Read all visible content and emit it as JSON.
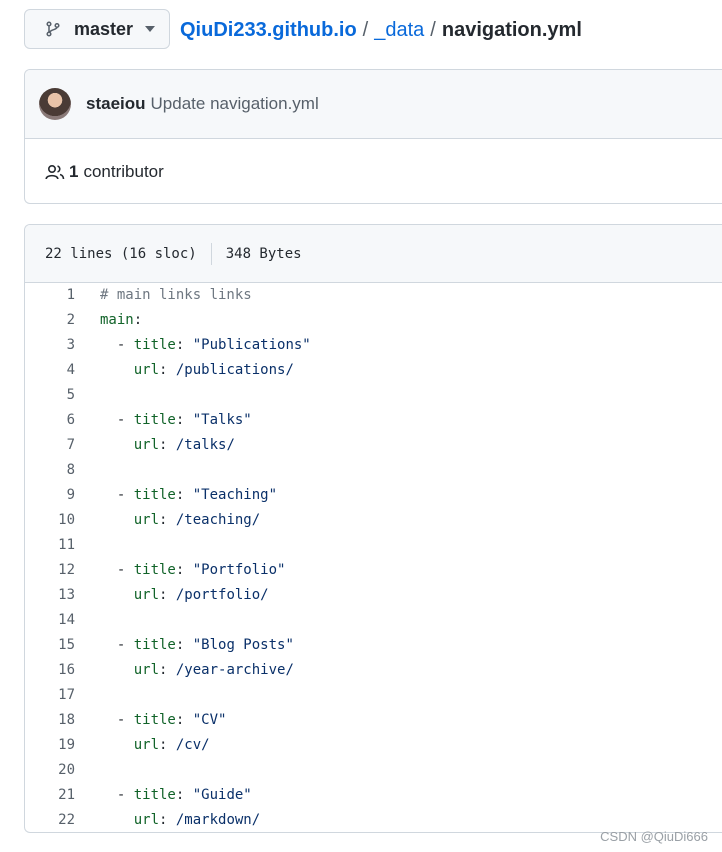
{
  "branch": {
    "name": "master",
    "icon": "git-branch-icon"
  },
  "breadcrumb": {
    "repo": "QiuDi233.github.io",
    "separator": "/",
    "folder": "_data",
    "file": "navigation.yml"
  },
  "commit": {
    "author": "staeiou",
    "message": "Update navigation.yml"
  },
  "contributors": {
    "count": "1",
    "label": "contributor"
  },
  "file_info": {
    "lines": "22 lines (16 sloc)",
    "size": "348 Bytes"
  },
  "code_lines": [
    {
      "n": "1",
      "tokens": [
        {
          "t": "comment",
          "v": "# main links links"
        }
      ]
    },
    {
      "n": "2",
      "tokens": [
        {
          "t": "key",
          "v": "main"
        },
        {
          "t": "plain",
          "v": ":"
        }
      ]
    },
    {
      "n": "3",
      "tokens": [
        {
          "t": "plain",
          "v": "  - "
        },
        {
          "t": "key",
          "v": "title"
        },
        {
          "t": "plain",
          "v": ": "
        },
        {
          "t": "str",
          "v": "\"Publications\""
        }
      ]
    },
    {
      "n": "4",
      "tokens": [
        {
          "t": "plain",
          "v": "    "
        },
        {
          "t": "key",
          "v": "url"
        },
        {
          "t": "plain",
          "v": ": "
        },
        {
          "t": "str",
          "v": "/publications/"
        }
      ]
    },
    {
      "n": "5",
      "tokens": []
    },
    {
      "n": "6",
      "tokens": [
        {
          "t": "plain",
          "v": "  - "
        },
        {
          "t": "key",
          "v": "title"
        },
        {
          "t": "plain",
          "v": ": "
        },
        {
          "t": "str",
          "v": "\"Talks\""
        }
      ]
    },
    {
      "n": "7",
      "tokens": [
        {
          "t": "plain",
          "v": "    "
        },
        {
          "t": "key",
          "v": "url"
        },
        {
          "t": "plain",
          "v": ": "
        },
        {
          "t": "str",
          "v": "/talks/"
        }
      ]
    },
    {
      "n": "8",
      "tokens": []
    },
    {
      "n": "9",
      "tokens": [
        {
          "t": "plain",
          "v": "  - "
        },
        {
          "t": "key",
          "v": "title"
        },
        {
          "t": "plain",
          "v": ": "
        },
        {
          "t": "str",
          "v": "\"Teaching\""
        }
      ]
    },
    {
      "n": "10",
      "tokens": [
        {
          "t": "plain",
          "v": "    "
        },
        {
          "t": "key",
          "v": "url"
        },
        {
          "t": "plain",
          "v": ": "
        },
        {
          "t": "str",
          "v": "/teaching/"
        }
      ]
    },
    {
      "n": "11",
      "tokens": []
    },
    {
      "n": "12",
      "tokens": [
        {
          "t": "plain",
          "v": "  - "
        },
        {
          "t": "key",
          "v": "title"
        },
        {
          "t": "plain",
          "v": ": "
        },
        {
          "t": "str",
          "v": "\"Portfolio\""
        }
      ]
    },
    {
      "n": "13",
      "tokens": [
        {
          "t": "plain",
          "v": "    "
        },
        {
          "t": "key",
          "v": "url"
        },
        {
          "t": "plain",
          "v": ": "
        },
        {
          "t": "str",
          "v": "/portfolio/"
        }
      ]
    },
    {
      "n": "14",
      "tokens": []
    },
    {
      "n": "15",
      "tokens": [
        {
          "t": "plain",
          "v": "  - "
        },
        {
          "t": "key",
          "v": "title"
        },
        {
          "t": "plain",
          "v": ": "
        },
        {
          "t": "str",
          "v": "\"Blog Posts\""
        }
      ]
    },
    {
      "n": "16",
      "tokens": [
        {
          "t": "plain",
          "v": "    "
        },
        {
          "t": "key",
          "v": "url"
        },
        {
          "t": "plain",
          "v": ": "
        },
        {
          "t": "str",
          "v": "/year-archive/"
        }
      ]
    },
    {
      "n": "17",
      "tokens": []
    },
    {
      "n": "18",
      "tokens": [
        {
          "t": "plain",
          "v": "  - "
        },
        {
          "t": "key",
          "v": "title"
        },
        {
          "t": "plain",
          "v": ": "
        },
        {
          "t": "str",
          "v": "\"CV\""
        }
      ]
    },
    {
      "n": "19",
      "tokens": [
        {
          "t": "plain",
          "v": "    "
        },
        {
          "t": "key",
          "v": "url"
        },
        {
          "t": "plain",
          "v": ": "
        },
        {
          "t": "str",
          "v": "/cv/"
        }
      ]
    },
    {
      "n": "20",
      "tokens": []
    },
    {
      "n": "21",
      "tokens": [
        {
          "t": "plain",
          "v": "  - "
        },
        {
          "t": "key",
          "v": "title"
        },
        {
          "t": "plain",
          "v": ": "
        },
        {
          "t": "str",
          "v": "\"Guide\""
        }
      ]
    },
    {
      "n": "22",
      "tokens": [
        {
          "t": "plain",
          "v": "    "
        },
        {
          "t": "key",
          "v": "url"
        },
        {
          "t": "plain",
          "v": ": "
        },
        {
          "t": "str",
          "v": "/markdown/"
        }
      ]
    }
  ],
  "watermark": "CSDN @QiuDi666",
  "colors": {
    "link": "#0969da",
    "yaml_key": "#116329",
    "yaml_string": "#0a3069",
    "comment": "#6e7781",
    "border": "#d0d7de",
    "header_bg": "#f6f8fa"
  }
}
